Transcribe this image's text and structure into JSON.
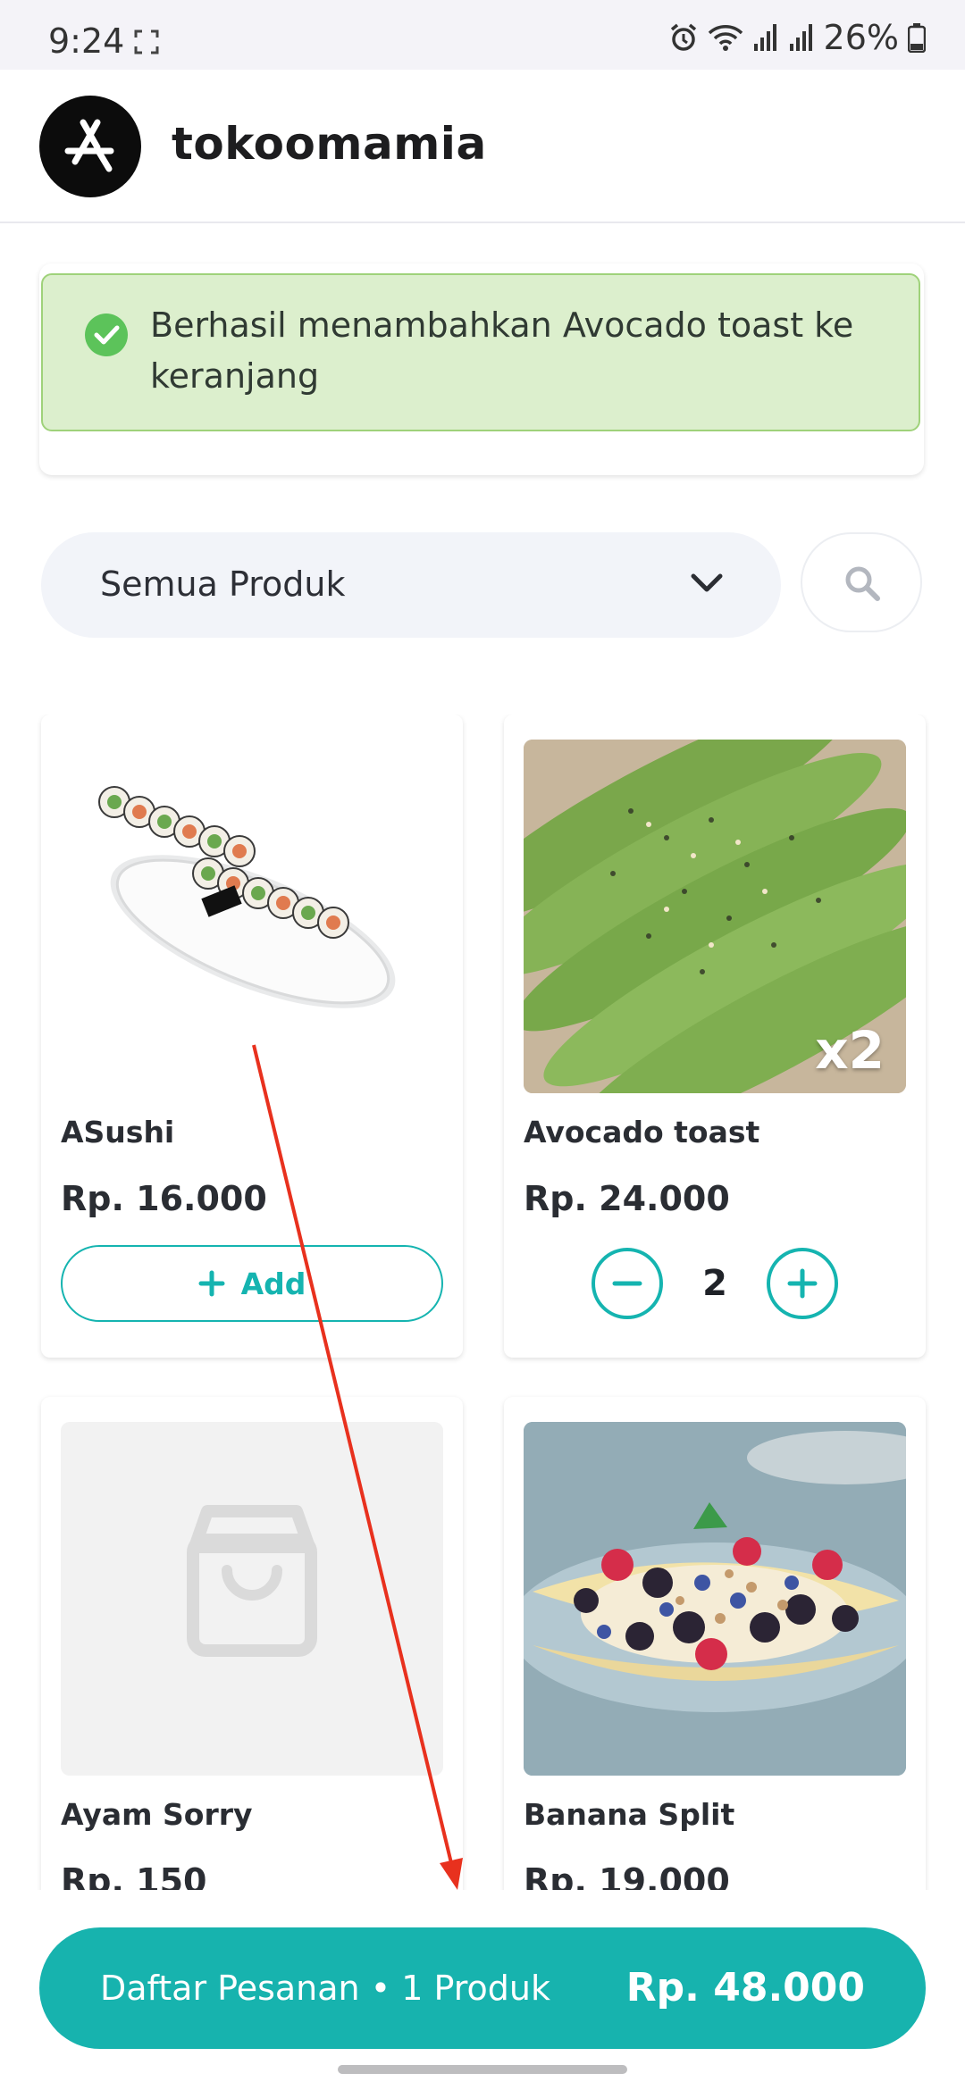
{
  "status_bar": {
    "time": "9:24",
    "battery": "26%"
  },
  "header": {
    "store_name": "tokoomamia"
  },
  "toast": {
    "message": "Berhasil menambahkan Avocado toast ke keranjang"
  },
  "filter": {
    "selected": "Semua Produk"
  },
  "products": [
    {
      "name": "ASushi",
      "price": "Rp. 16.000",
      "add_label": "Add"
    },
    {
      "name": "Avocado toast",
      "price": "Rp. 24.000",
      "quantity": "2",
      "badge": "x2"
    },
    {
      "name": "Ayam Sorry",
      "price": "Rp. 150"
    },
    {
      "name": "Banana Split",
      "price": "Rp. 19.000"
    }
  ],
  "order_bar": {
    "label": "Daftar Pesanan • 1 Produk",
    "total": "Rp. 48.000"
  },
  "colors": {
    "accent": "#15b4b0",
    "toast_bg": "#dcefcd",
    "toast_border": "#9fd27a",
    "annotation": "#e8311e"
  }
}
